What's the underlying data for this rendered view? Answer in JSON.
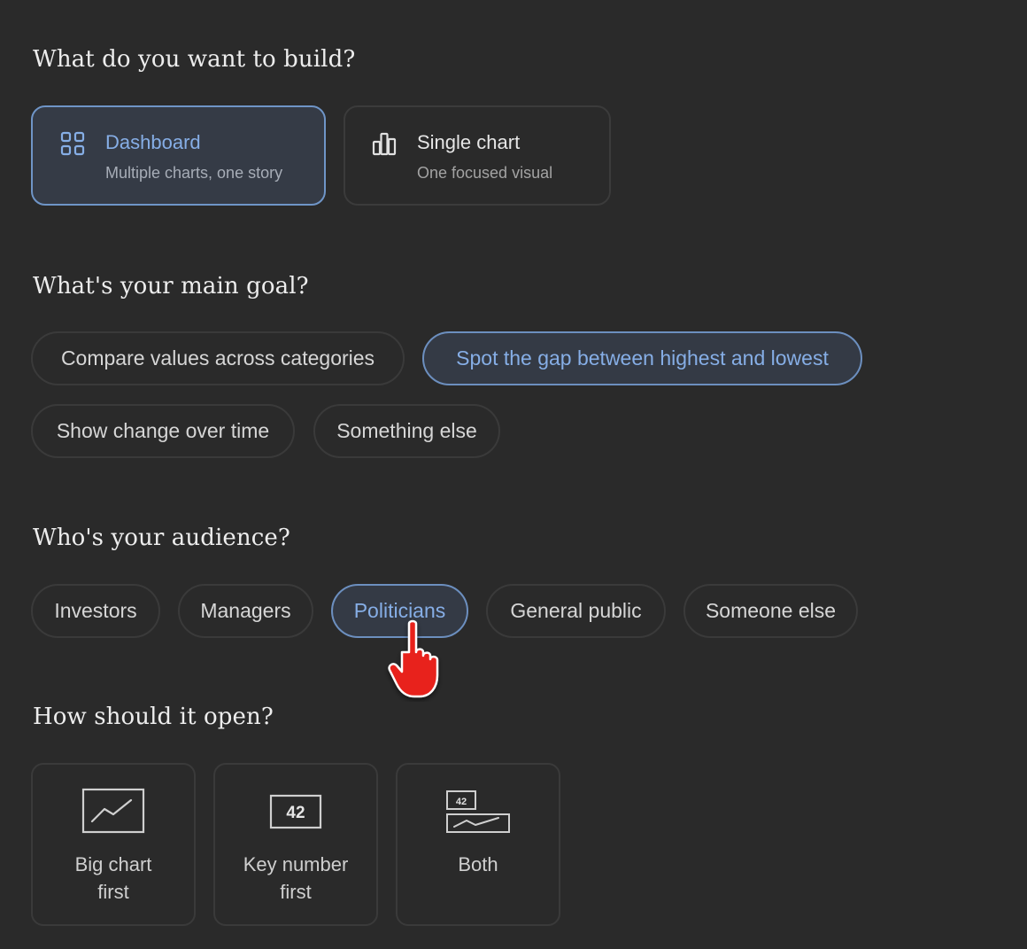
{
  "build": {
    "heading": "What do you want to build?",
    "options": [
      {
        "title": "Dashboard",
        "subtitle": "Multiple charts, one story",
        "icon": "grid-icon",
        "selected": true
      },
      {
        "title": "Single chart",
        "subtitle": "One focused visual",
        "icon": "bar-chart-icon",
        "selected": false
      }
    ]
  },
  "goal": {
    "heading": "What's your main goal?",
    "options": [
      {
        "label": "Compare values across categories",
        "selected": false
      },
      {
        "label": "Spot the gap between highest and lowest",
        "selected": true
      },
      {
        "label": "Show change over time",
        "selected": false
      },
      {
        "label": "Something else",
        "selected": false
      }
    ]
  },
  "audience": {
    "heading": "Who's your audience?",
    "options": [
      {
        "label": "Investors",
        "selected": false
      },
      {
        "label": "Managers",
        "selected": false
      },
      {
        "label": "Politicians",
        "selected": true
      },
      {
        "label": "General public",
        "selected": false
      },
      {
        "label": "Someone else",
        "selected": false
      }
    ]
  },
  "open": {
    "heading": "How should it open?",
    "options": [
      {
        "label": "Big chart\nfirst",
        "icon": "line-chart-icon"
      },
      {
        "label": "Key number\nfirst",
        "icon": "key-number-icon",
        "icon_text": "42"
      },
      {
        "label": "Both",
        "icon": "number-and-chart-icon",
        "icon_text": "42"
      }
    ]
  },
  "colors": {
    "background": "#2a2a2a",
    "accent": "#86aee6",
    "selected_bg": "#343a45",
    "cursor": "#e8231a"
  }
}
